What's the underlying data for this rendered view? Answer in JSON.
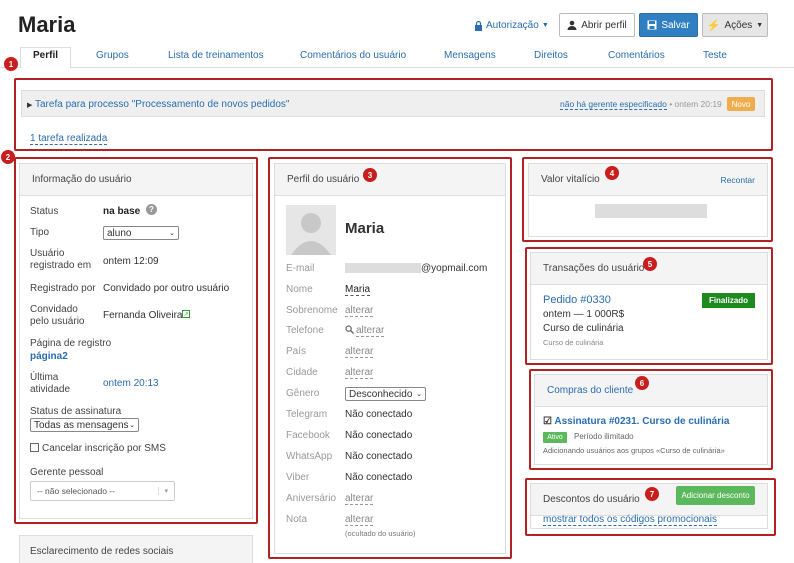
{
  "header": {
    "title": "Maria",
    "authorization": "Autorização",
    "open_profile": "Abrir perfil",
    "save": "Salvar",
    "actions": "Ações"
  },
  "tabs": [
    {
      "label": "Perfil",
      "active": true
    },
    {
      "label": "Grupos"
    },
    {
      "label": "Lista de treinamentos"
    },
    {
      "label": "Comentários do usuário"
    },
    {
      "label": "Mensagens"
    },
    {
      "label": "Direitos"
    },
    {
      "label": "Comentários"
    },
    {
      "label": "Teste"
    }
  ],
  "badges": [
    "1",
    "2",
    "3",
    "4",
    "5",
    "6",
    "7"
  ],
  "task": {
    "title": "Tarefa para processo \"Processamento de novos pedidos\"",
    "no_manager": "não há gerente especificado",
    "time": "• ontem 20:19",
    "status": "Novo",
    "done_link": "1 tarefa realizada"
  },
  "user_info": {
    "heading": "Informação do usuário",
    "status_label": "Status",
    "status_value": "na base",
    "type_label": "Tipo",
    "type_value": "aluno",
    "registered_label": "Usuário registrado em",
    "registered_value": "ontem 12:09",
    "registered_by_label": "Registrado por",
    "registered_by_value": "Convidado por outro usuário",
    "invited_label": "Convidado pelo usuário",
    "invited_value": "Fernanda Oliveira",
    "reg_page_label": "Página de registro",
    "reg_page_value": "página2",
    "last_activity_label": "Última atividade",
    "last_activity_value": "ontem 20:13",
    "subscription_label": "Status de assinatura",
    "subscription_value": "Todas as mensagens",
    "sms_label": "Cancelar inscrição por SMS",
    "manager_label": "Gerente pessoal",
    "manager_value": "-- não selecionado --"
  },
  "social_heading": "Esclarecimento de redes sociais",
  "profile": {
    "heading": "Perfil do usuário",
    "name": "Maria",
    "fields": [
      {
        "label": "E-mail",
        "value": "@yopmail.com",
        "style": "plain"
      },
      {
        "label": "Nome",
        "value": "Maria",
        "style": "dark"
      },
      {
        "label": "Sobrenome",
        "value": "alterar",
        "style": "dotted"
      },
      {
        "label": "Telefone",
        "value": "alterar",
        "style": "dotted"
      },
      {
        "label": "País",
        "value": "alterar",
        "style": "dotted"
      },
      {
        "label": "Cidade",
        "value": "alterar",
        "style": "dotted"
      },
      {
        "label": "Gênero",
        "value": "Desconhecido",
        "style": "select"
      },
      {
        "label": "Telegram",
        "value": "Não conectado",
        "style": "plain"
      },
      {
        "label": "Facebook",
        "value": "Não conectado",
        "style": "plain"
      },
      {
        "label": "WhatsApp",
        "value": "Não conectado",
        "style": "plain"
      },
      {
        "label": "Viber",
        "value": "Não conectado",
        "style": "plain"
      },
      {
        "label": "Aniversário",
        "value": "alterar",
        "style": "dotted"
      },
      {
        "label": "Nota",
        "value": "alterar",
        "style": "dotted"
      }
    ],
    "note_hint": "(ocultado do usuário)"
  },
  "lifetime": {
    "heading": "Valor vitalício",
    "recount": "Recontar"
  },
  "transactions": {
    "heading": "Transações do usuário",
    "order": "Pedido #0330",
    "status": "Finalizado",
    "amount": "ontem — 1 000R$",
    "course": "Curso de culinária",
    "course_small": "Curso de culinária"
  },
  "purchases": {
    "heading": "Compras do cliente",
    "subscription": "Assinatura #0231. Curso de culinária",
    "active": "Ativo",
    "period": "Período ilimitado",
    "note": "Adicionando usuários aos grupos «Curso de culinária»"
  },
  "discounts": {
    "heading": "Descontos do usuário",
    "add": "Adicionar desconto",
    "show_all": "mostrar todos os códigos promocionais"
  },
  "colors": {
    "frame": "#b22222",
    "save": "#2f7fc2",
    "finalized": "#1e8a1e",
    "new_badge": "#f0ad4e"
  }
}
